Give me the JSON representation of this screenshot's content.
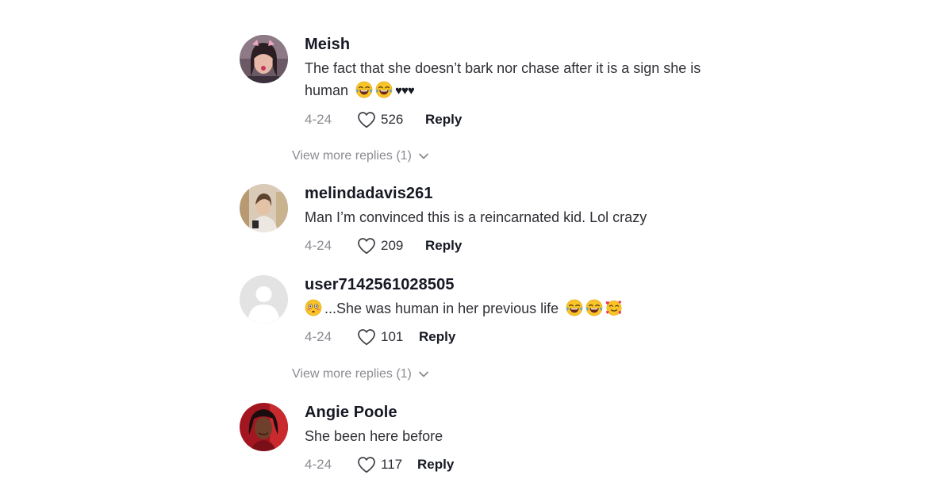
{
  "comments": [
    {
      "username": "Meish",
      "text_line1": "The fact that she doesn’t bark nor chase after it is a sign she is",
      "text_line2": "human",
      "trailing": "♥♥♥",
      "date": "4-24",
      "likes": "526",
      "reply_label": "Reply"
    },
    {
      "username": "melindadavis261",
      "text": "Man I’m convinced this is a reincarnated kid. Lol crazy",
      "date": "4-24",
      "likes": "209",
      "reply_label": "Reply"
    },
    {
      "username": "user7142561028505",
      "text": "...She was human in her previous life",
      "date": "4-24",
      "likes": "101",
      "reply_label": "Reply"
    },
    {
      "username": "Angie Poole",
      "text": "She been here before",
      "date": "4-24",
      "likes": "117",
      "reply_label": "Reply"
    }
  ],
  "view_more": [
    {
      "label": "View more replies (1)"
    },
    {
      "label": "View more replies (1)"
    }
  ],
  "icons": {
    "like": "heart-outline-icon",
    "expand": "chevron-down-icon",
    "emoji_laugh": "tears-of-joy-emoji",
    "emoji_flushed": "flushed-face-emoji",
    "emoji_hearts": "smiling-face-with-hearts-emoji"
  },
  "colors": {
    "primary_text": "#161823",
    "secondary_text": "#8a8b91",
    "background": "#ffffff"
  }
}
